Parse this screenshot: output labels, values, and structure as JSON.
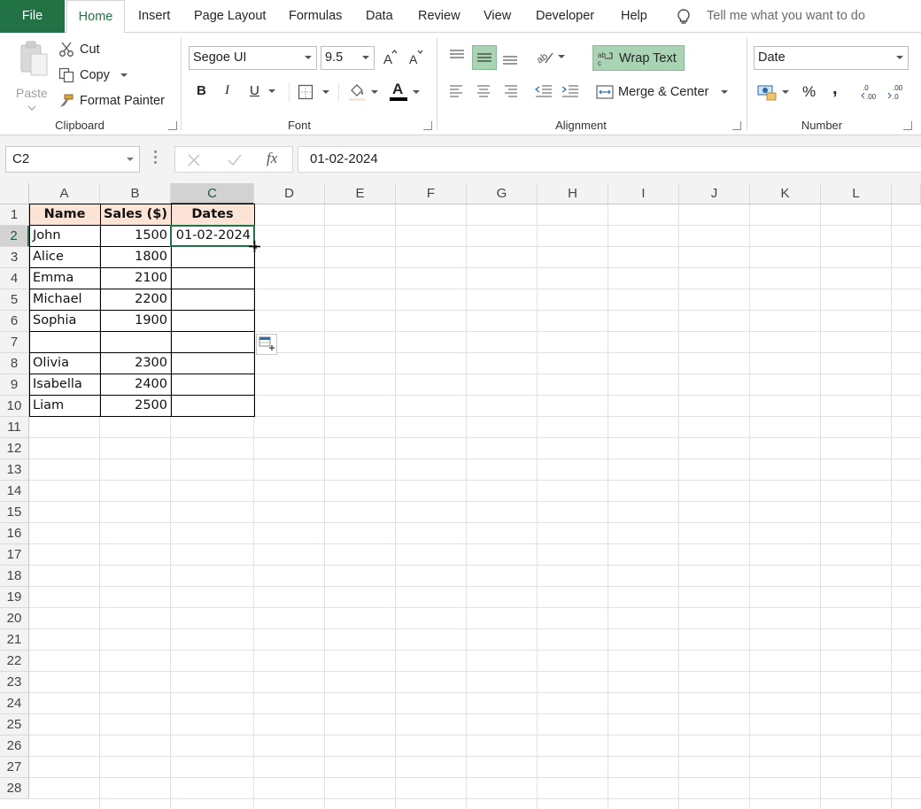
{
  "tabs": {
    "file": "File",
    "home": "Home",
    "insert": "Insert",
    "page_layout": "Page Layout",
    "formulas": "Formulas",
    "data": "Data",
    "review": "Review",
    "view": "View",
    "developer": "Developer",
    "help": "Help",
    "tell_me": "Tell me what you want to do"
  },
  "clipboard": {
    "paste": "Paste",
    "cut": "Cut",
    "copy": "Copy",
    "format_painter": "Format Painter",
    "label": "Clipboard"
  },
  "font": {
    "name": "Segoe UI",
    "size": "9.5",
    "bold": "B",
    "italic": "I",
    "underline": "U",
    "font_color": "A",
    "label": "Font"
  },
  "alignment": {
    "wrap_text": "Wrap Text",
    "merge_center": "Merge & Center",
    "label": "Alignment"
  },
  "number": {
    "format": "Date",
    "percent": "%",
    "comma": ",",
    "label": "Number"
  },
  "formula_bar": {
    "name_box": "C2",
    "fx": "fx",
    "value": "01-02-2024"
  },
  "columns": [
    "A",
    "B",
    "C",
    "D",
    "E",
    "F",
    "G",
    "H",
    "I",
    "J",
    "K",
    "L"
  ],
  "rows": [
    "1",
    "2",
    "3",
    "4",
    "5",
    "6",
    "7",
    "8",
    "9",
    "10",
    "11",
    "12",
    "13",
    "14",
    "15",
    "16",
    "17",
    "18",
    "19",
    "20",
    "21",
    "22",
    "23",
    "24",
    "25",
    "26",
    "27",
    "28"
  ],
  "table": {
    "headers": [
      "Name",
      "Sales ($)",
      "Dates"
    ],
    "rows": [
      {
        "name": "John",
        "sales": "1500",
        "date": "01-02-2024"
      },
      {
        "name": "Alice",
        "sales": "1800",
        "date": ""
      },
      {
        "name": "Emma",
        "sales": "2100",
        "date": ""
      },
      {
        "name": "Michael",
        "sales": "2200",
        "date": ""
      },
      {
        "name": "Sophia",
        "sales": "1900",
        "date": ""
      },
      {
        "name": "",
        "sales": "",
        "date": ""
      },
      {
        "name": "Olivia",
        "sales": "2300",
        "date": ""
      },
      {
        "name": "Isabella",
        "sales": "2400",
        "date": ""
      },
      {
        "name": "Liam",
        "sales": "2500",
        "date": ""
      }
    ]
  },
  "colors": {
    "accent": "#217346",
    "header_fill": "#fbe3d6",
    "highlight": "#a8d4b4"
  }
}
